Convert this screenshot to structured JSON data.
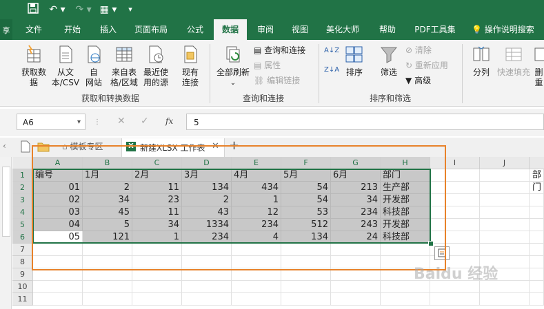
{
  "titlebar": {
    "save_icon": "save-icon",
    "undo_icon": "undo-icon",
    "redo_icon": "redo-icon",
    "form_icon": "form-icon",
    "customize_icon": "customize-qat-icon"
  },
  "left_strip": {
    "text": "享"
  },
  "tabs": [
    "文件",
    "开始",
    "插入",
    "页面布局",
    "公式",
    "数据",
    "审阅",
    "视图",
    "美化大师",
    "帮助",
    "PDF工具集",
    "操作说明搜索"
  ],
  "active_tab": "数据",
  "ribbon": {
    "get_data": "获取数\n据",
    "from_text_csv": "从文\n本/CSV",
    "from_web": "自\n网站",
    "from_table": "来自表\n格/区域",
    "recent_sources": "最近使\n用的源",
    "existing_connections": "现有\n连接",
    "group_get_transform": "获取和转换数据",
    "refresh_all": "全部刷新",
    "queries_connections": "查询和连接",
    "properties": "属性",
    "edit_links": "编辑链接",
    "group_queries": "查询和连接",
    "sort_az": "A↓Z",
    "sort_za": "Z↓A",
    "sort": "排序",
    "filter": "筛选",
    "clear": "清除",
    "reapply": "重新应用",
    "advanced": "高级",
    "group_sort_filter": "排序和筛选",
    "text_to_columns": "分列",
    "flash_fill": "快速填充",
    "remove_dup": "删\n重"
  },
  "formula_bar": {
    "name_box": "A6",
    "fx": "fx",
    "value": "5"
  },
  "doc_tabs": {
    "templates": "模板专区",
    "workbook": "新建XLSX 工作表"
  },
  "sheet": {
    "columns": [
      "A",
      "B",
      "C",
      "D",
      "E",
      "F",
      "G",
      "H",
      "I",
      "J"
    ],
    "rows": [
      "1",
      "2",
      "3",
      "4",
      "5",
      "6",
      "7",
      "8",
      "9",
      "10",
      "11"
    ],
    "header_row": [
      "编号",
      "1月",
      "2月",
      "3月",
      "4月",
      "5月",
      "6月",
      "部门"
    ],
    "data": [
      [
        "01",
        "2",
        "11",
        "134",
        "434",
        "54",
        "213",
        "生产部"
      ],
      [
        "02",
        "34",
        "23",
        "2",
        "1",
        "54",
        "34",
        "开发部"
      ],
      [
        "03",
        "45",
        "11",
        "43",
        "12",
        "53",
        "234",
        "科技部"
      ],
      [
        "04",
        "5",
        "34",
        "1334",
        "234",
        "512",
        "243",
        "开发部"
      ],
      [
        "05",
        "121",
        "1",
        "234",
        "4",
        "134",
        "24",
        "科技部"
      ]
    ],
    "overflow_text": "部门"
  },
  "watermark": "Baidu 经验",
  "colors": {
    "accent": "#217346",
    "highlight_box": "#e8822a"
  }
}
